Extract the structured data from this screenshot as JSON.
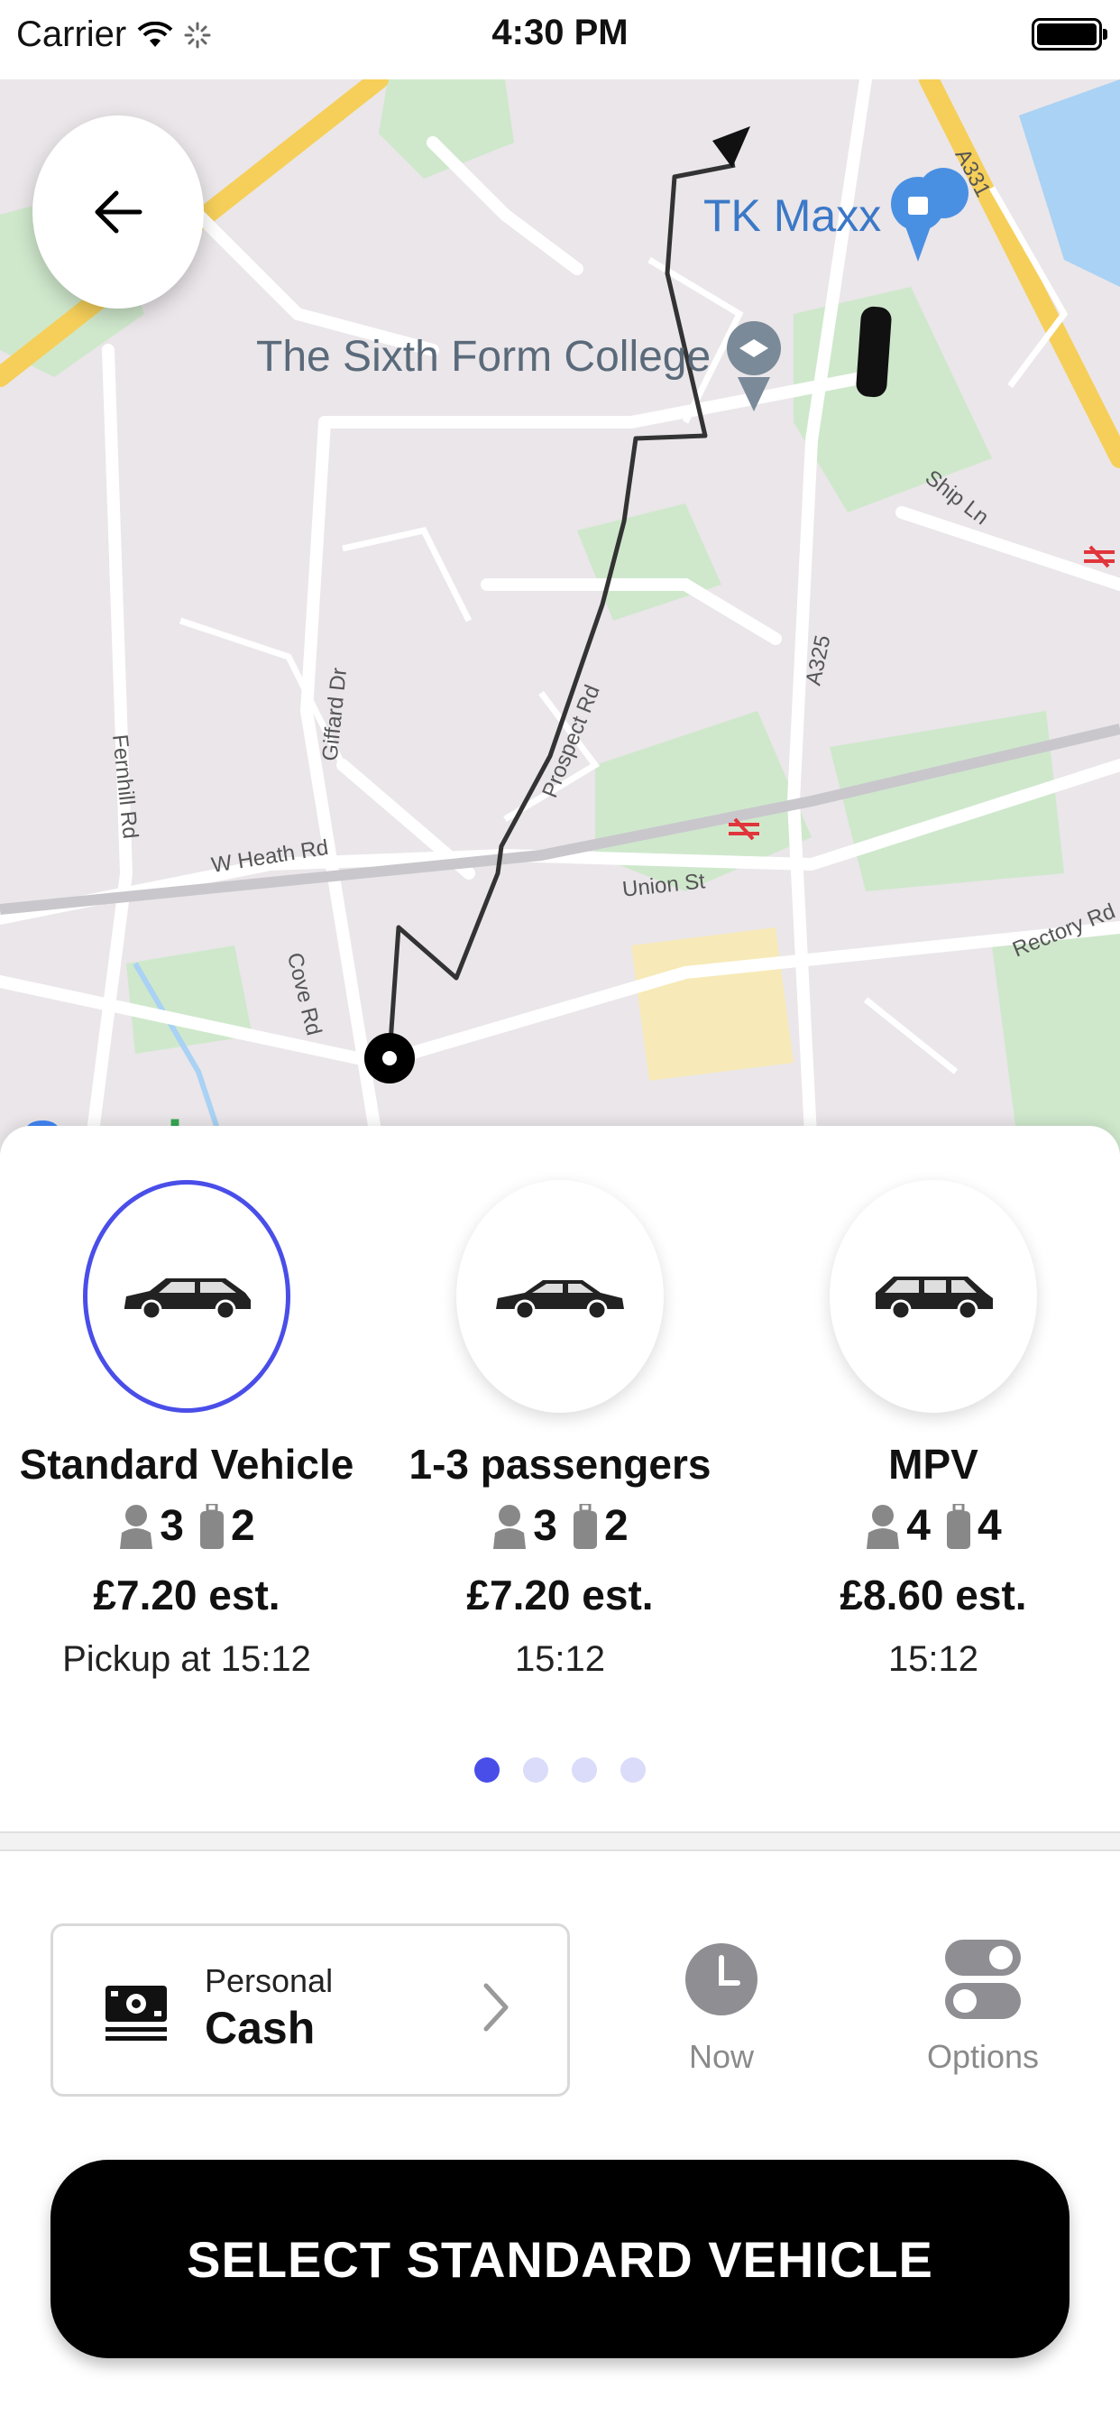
{
  "status_bar": {
    "carrier": "Carrier",
    "time": "4:30 PM"
  },
  "map": {
    "labels": {
      "tk_maxx": "TK Maxx",
      "college": "The Sixth Form College",
      "a331": "A331",
      "ship_ln": "Ship Ln",
      "a325": "A325",
      "giffard_dr": "Giffard Dr",
      "fernhill_rd": "Fernhill Rd",
      "prospect_rd": "Prospect Rd",
      "w_heath_rd": "W Heath Rd",
      "union_st": "Union St",
      "rectory_rd": "Rectory Rd",
      "cove_rd": "Cove Rd"
    },
    "google": "Google"
  },
  "vehicles": [
    {
      "name": "Standard Vehicle",
      "passengers": "3",
      "luggage": "2",
      "price": "£7.20 est.",
      "time": "Pickup at 15:12",
      "selected": true
    },
    {
      "name": "1-3 passengers",
      "passengers": "3",
      "luggage": "2",
      "price": "£7.20 est.",
      "time": "15:12",
      "selected": false
    },
    {
      "name": "MPV",
      "passengers": "4",
      "luggage": "4",
      "price": "£8.60 est.",
      "time": "15:12",
      "selected": false
    }
  ],
  "pager": {
    "total": 4,
    "active": 0
  },
  "payment": {
    "type": "Personal",
    "method": "Cash"
  },
  "time_option": {
    "label": "Now"
  },
  "options": {
    "label": "Options"
  },
  "cta": {
    "label": "SELECT STANDARD VEHICLE"
  },
  "colors": {
    "accent": "#4a4ee8",
    "route": "#333333",
    "button": "#000000"
  }
}
